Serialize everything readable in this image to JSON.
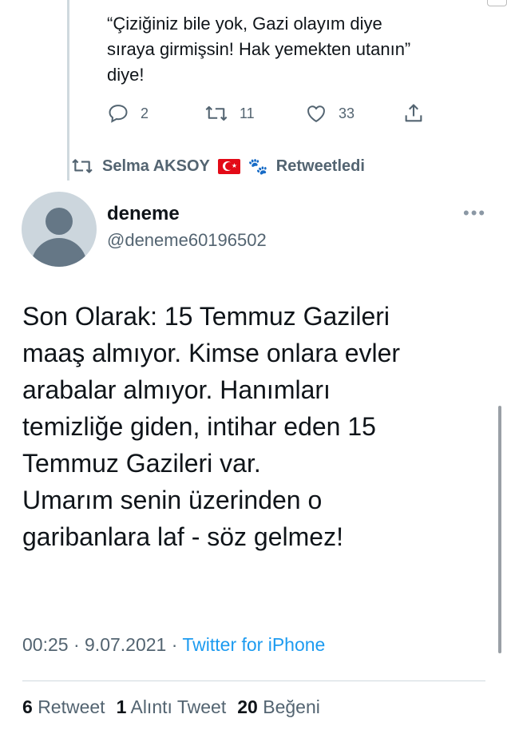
{
  "previous_tweet": {
    "text": "“Çiziğiniz bile yok, Gazi olayım diye\nsıraya girmişsin! Hak yemekten utanın”\ndiye!",
    "reply_count": "2",
    "retweet_count": "11",
    "like_count": "33"
  },
  "retweet_context": {
    "user": "Selma AKSOY",
    "emoji": "🐾",
    "label": "Retweetledi"
  },
  "tweet": {
    "display_name": "deneme",
    "handle": "@deneme60196502",
    "more": "•••",
    "text": "Son Olarak: 15 Temmuz Gazileri\nmaaş almıyor. Kimse onlara evler\narabalar almıyor. Hanımları\ntemizliğe giden, intihar eden 15\nTemmuz Gazileri var.\nUmarım senin üzerinden o\ngaribanlara laf - söz gelmez!",
    "time": "00:25",
    "sep1": " · ",
    "date": "9.07.2021",
    "sep2": " · ",
    "source": "Twitter for iPhone"
  },
  "stats": {
    "retweets_count": "6",
    "retweets_label": "Retweet",
    "quotes_count": "1",
    "quotes_label": "Alıntı Tweet",
    "likes_count": "20",
    "likes_label": "Beğeni"
  },
  "colors": {
    "text": "#0f1419",
    "secondary": "#536471",
    "link": "#1d9bf0",
    "divider": "#cfd9de"
  }
}
